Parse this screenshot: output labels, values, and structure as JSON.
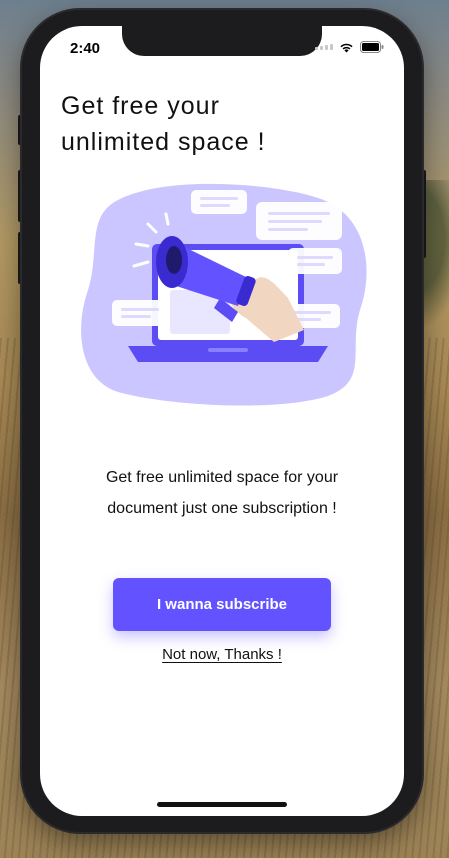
{
  "status_bar": {
    "time": "2:40"
  },
  "screen": {
    "title_line1": "Get free your",
    "title_line2": "unlimited space !",
    "description_line1": "Get free unlimited space for your",
    "description_line2": "document just one subscription !",
    "subscribe_label": "I wanna subscribe",
    "dismiss_label": "Not now, Thanks !"
  },
  "colors": {
    "accent": "#6352ff",
    "illustration_bg": "#cbc6ff",
    "text": "#111111"
  },
  "icons": [
    "wifi-icon",
    "battery-icon",
    "cellular-signal-icon",
    "megaphone-illustration"
  ]
}
